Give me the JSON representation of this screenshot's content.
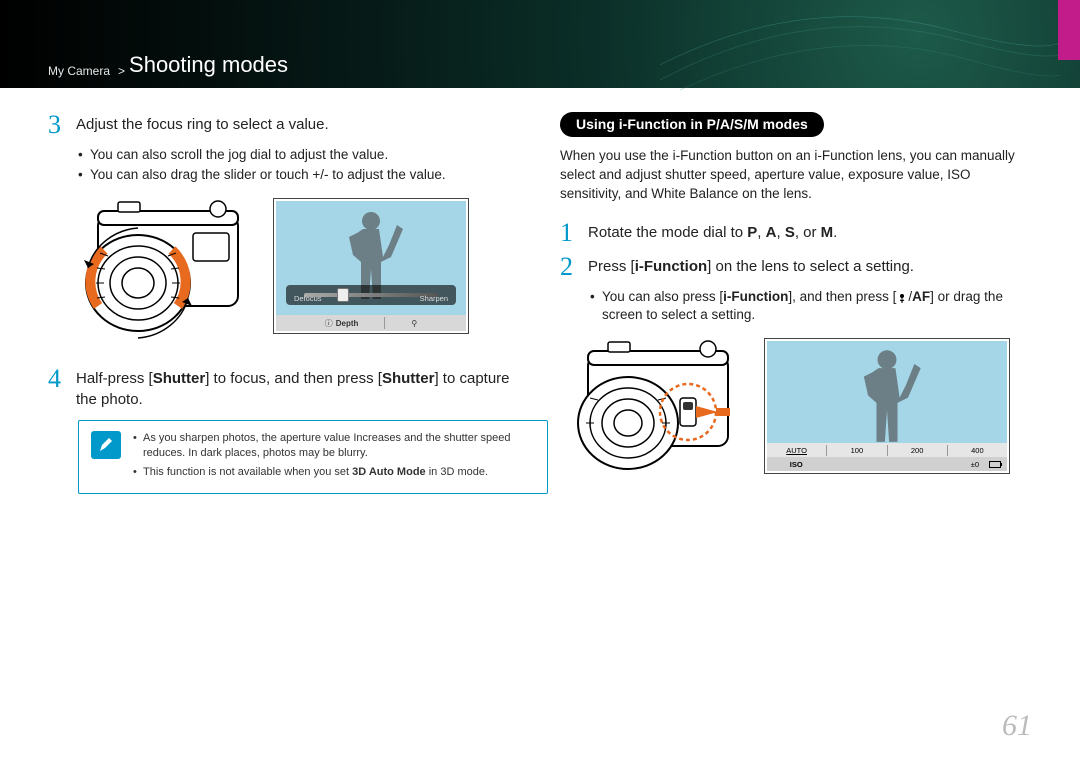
{
  "breadcrumb": {
    "section": "My Camera",
    "sep": ">",
    "title": "Shooting modes"
  },
  "left": {
    "step3": {
      "num": "3",
      "text": "Adjust the focus ring to select a value.",
      "bullets": [
        "You can also scroll the jog dial to adjust the value.",
        "You can also drag the slider or touch +/- to adjust the value."
      ]
    },
    "screen1": {
      "left_label": "Defocus",
      "right_label": "Sharpen",
      "footer_center": "Depth",
      "footer_info_glyph": "ⓘ",
      "footer_mag_glyph": "⚲"
    },
    "step4": {
      "num": "4",
      "text_pre": "Half-press [",
      "text_b1": "Shutter",
      "text_mid": "] to focus, and then press [",
      "text_b2": "Shutter",
      "text_post": "] to capture the photo."
    },
    "note": {
      "items": [
        "As you sharpen photos, the aperture value Increases and the shutter speed reduces. In dark places, photos may be blurry.",
        "This function is not available when you set 3D Auto Mode in 3D mode."
      ],
      "bold_phrase": "3D Auto Mode"
    }
  },
  "right": {
    "pill_pre": "Using i-Function in ",
    "pill_modes": "P/A/S/M",
    "pill_post": " modes",
    "intro": "When you use the i-Function button on an i-Function lens, you can manually select and adjust shutter speed, aperture value, exposure value, ISO sensitivity, and White Balance on the lens.",
    "step1": {
      "num": "1",
      "pre": "Rotate the mode dial to ",
      "m1": "P",
      "c1": ", ",
      "m2": "A",
      "c2": ", ",
      "m3": "S",
      "c3": ", or ",
      "m4": "M",
      "period": "."
    },
    "step2": {
      "num": "2",
      "pre": "Press [",
      "bold": "i-Function",
      "post": "] on the lens to select a setting.",
      "sub_pre": "You can also press [",
      "sub_bold": "i-Function",
      "sub_mid": "], and then press [",
      "sub_af": "AF",
      "sub_post": "] or drag the screen to select a setting."
    },
    "screen2": {
      "iso_cells": [
        "AUTO",
        "100",
        "200",
        "400"
      ],
      "iso_label": "ISO",
      "exp": "±0"
    }
  },
  "page_number": "61"
}
